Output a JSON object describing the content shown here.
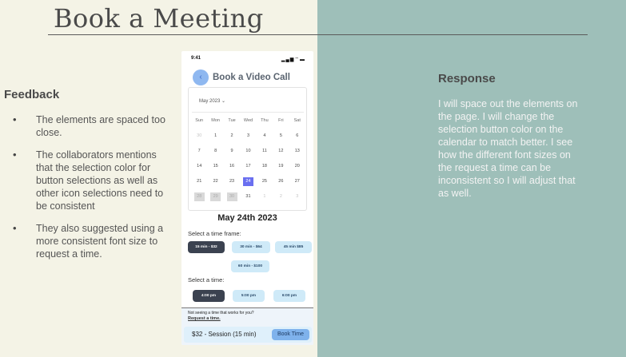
{
  "slide": {
    "title": "Book a Meeting"
  },
  "feedback": {
    "heading": "Feedback",
    "items": [
      "The elements are spaced too close.",
      "The collaborators mentions that the selection color for button selections as well as other icon selections need to be consistent",
      "They also suggested using a more consistent font size to request a time."
    ]
  },
  "response": {
    "heading": "Response",
    "text": "I will space out the elements on the page. I will change the selection button color on the calendar to match better. I see how the different font sizes on the request a time can be inconsistent so I will adjust that as well."
  },
  "phone": {
    "time": "9:41",
    "status_icons": "signal-wifi-battery-icons",
    "title": "Book a Video Call",
    "calendar": {
      "month": "May 2023",
      "weekdays": [
        "Sun",
        "Mon",
        "Tue",
        "Wed",
        "Thu",
        "Fri",
        "Sat"
      ],
      "days": [
        {
          "d": "30",
          "s": "muted"
        },
        {
          "d": "1",
          "s": ""
        },
        {
          "d": "2",
          "s": ""
        },
        {
          "d": "3",
          "s": ""
        },
        {
          "d": "4",
          "s": ""
        },
        {
          "d": "5",
          "s": ""
        },
        {
          "d": "6",
          "s": ""
        },
        {
          "d": "7",
          "s": ""
        },
        {
          "d": "8",
          "s": ""
        },
        {
          "d": "9",
          "s": ""
        },
        {
          "d": "10",
          "s": ""
        },
        {
          "d": "11",
          "s": ""
        },
        {
          "d": "12",
          "s": ""
        },
        {
          "d": "13",
          "s": ""
        },
        {
          "d": "14",
          "s": ""
        },
        {
          "d": "15",
          "s": ""
        },
        {
          "d": "16",
          "s": ""
        },
        {
          "d": "17",
          "s": ""
        },
        {
          "d": "18",
          "s": ""
        },
        {
          "d": "19",
          "s": ""
        },
        {
          "d": "20",
          "s": ""
        },
        {
          "d": "21",
          "s": ""
        },
        {
          "d": "22",
          "s": ""
        },
        {
          "d": "23",
          "s": ""
        },
        {
          "d": "24",
          "s": "sel"
        },
        {
          "d": "25",
          "s": ""
        },
        {
          "d": "26",
          "s": ""
        },
        {
          "d": "27",
          "s": ""
        },
        {
          "d": "28",
          "s": "grey"
        },
        {
          "d": "29",
          "s": "grey"
        },
        {
          "d": "30",
          "s": "grey"
        },
        {
          "d": "31",
          "s": ""
        },
        {
          "d": "1",
          "s": "muted"
        },
        {
          "d": "2",
          "s": "muted"
        },
        {
          "d": "3",
          "s": "muted"
        }
      ],
      "selected_color": "#6a6ff0"
    },
    "selected_date": "May 24th 2023",
    "timeframe_label": "Select a time frame:",
    "timeframes": [
      "15 min - $32",
      "30 min - $64",
      "45 min $85",
      "60 min - $100"
    ],
    "time_label": "Select a time:",
    "times": [
      "4:00 pm",
      "5:00 pm",
      "6:00 pm"
    ],
    "footer_question": "Not seeing a time that works for you?",
    "footer_link": "Request a time.",
    "session": "$32 - Session (15 min)",
    "book_button": "Book Time"
  },
  "colors": {
    "left_bg": "#f4f3e6",
    "right_bg": "#9ebfb9",
    "chip_selected": "#3b4250",
    "chip": "#cfeaf8",
    "book_button": "#7fb2ec"
  }
}
